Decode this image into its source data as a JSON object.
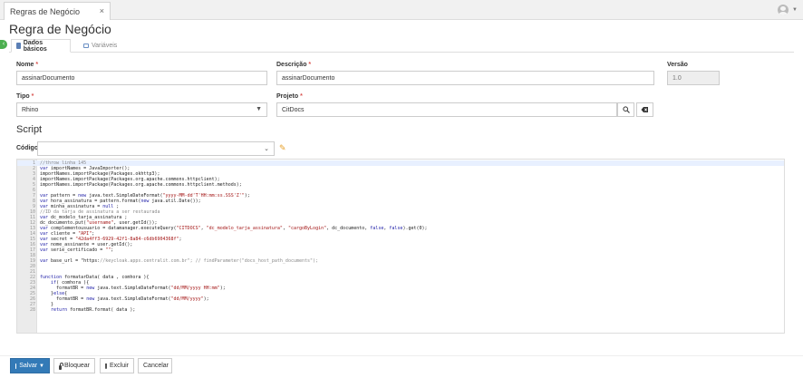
{
  "window": {
    "tab_label": "Regras de Negócio",
    "tab_close": "×"
  },
  "page": {
    "title": "Regra de Negócio"
  },
  "subtabs": [
    {
      "label": "Dados básicos"
    },
    {
      "label": "Variáveis"
    }
  ],
  "form": {
    "nome_label": "Nome",
    "nome_value": "assinarDocumento",
    "descricao_label": "Descrição",
    "descricao_value": "assinarDocumento",
    "versao_label": "Versão",
    "versao_value": "1.0",
    "tipo_label": "Tipo",
    "tipo_value": "Rhino",
    "projeto_label": "Projeto",
    "projeto_value": "CitDocs",
    "required_mark": "*"
  },
  "script": {
    "section_title": "Script",
    "codigo_label": "Código",
    "codigo_value": ""
  },
  "code_lines": [
    {
      "n": "1",
      "t": "//throw linha 145"
    },
    {
      "n": "2",
      "t": "var importNames = JavaImporter();"
    },
    {
      "n": "3",
      "t": "importNames.importPackage(Packages.okhttp3);"
    },
    {
      "n": "4",
      "t": "importNames.importPackage(Packages.org.apache.commons.httpclient);"
    },
    {
      "n": "5",
      "t": "importNames.importPackage(Packages.org.apache.commons.httpclient.methods);"
    },
    {
      "n": "6",
      "t": ""
    },
    {
      "n": "7",
      "t": "var pattern = new java.text.SimpleDateFormat(\"yyyy-MM-dd'T'HH:mm:ss.SSS'Z'\");"
    },
    {
      "n": "8",
      "t": "var hora_assinatura = pattern.format(new java.util.Date());"
    },
    {
      "n": "9",
      "t": "var minha_assinatura = null ;"
    },
    {
      "n": "10",
      "t": "//ID da tarja de assinatura a ser restaurada"
    },
    {
      "n": "11",
      "t": "var dc_modelo_tarja_assinatura ;"
    },
    {
      "n": "12",
      "t": "dc_documento.put(\"username\", user.getId());"
    },
    {
      "n": "13",
      "t": "var complementousuario = datamanager.executeQuery(\"CITDOCS\", \"dc_modelo_tarja_assinatura\", \"cargoByLogin\", dc_documento, false, false).get(0);"
    },
    {
      "n": "14",
      "t": "var cliente = \"API\";"
    },
    {
      "n": "15",
      "t": "var secret = \"42da4ff3-6929-42f1-8a84-c6db6904368f\";"
    },
    {
      "n": "16",
      "t": "var nome_assinante = user.getId();"
    },
    {
      "n": "17",
      "t": "var serie_certificado = \"\";"
    },
    {
      "n": "18",
      "t": ""
    },
    {
      "n": "19",
      "t": "var base_url = \"https://keycloak.apps.centralit.com.br\"; // findParameter(\"docs_host_path_documents\");"
    },
    {
      "n": "20",
      "t": ""
    },
    {
      "n": "21",
      "t": ""
    },
    {
      "n": "22",
      "t": "function formatarData( data , comhora ){"
    },
    {
      "n": "23",
      "t": "    if( comhora ){"
    },
    {
      "n": "24",
      "t": "      formatBR = new java.text.SimpleDateFormat(\"dd/MM/yyyy HH:mm\");"
    },
    {
      "n": "25",
      "t": "    }else{"
    },
    {
      "n": "26",
      "t": "      formatBR = new java.text.SimpleDateFormat(\"dd/MM/yyyy\");"
    },
    {
      "n": "27",
      "t": "    }"
    },
    {
      "n": "28",
      "t": "    return formatBR.format( data );"
    }
  ],
  "colors": {
    "code_comment": "#8a8a8a",
    "code_keyword": "#1a1aa6",
    "code_string": "#a31515",
    "primary": "#337ab7",
    "toggle": "#4caf50",
    "pencil": "#e6a02a"
  },
  "footer": {
    "save_label": "Salvar",
    "lock_label": "Bloquear",
    "delete_label": "Excluir",
    "cancel_label": "Cancelar"
  },
  "icons": {
    "search": "search-icon",
    "eraser": "eraser-icon",
    "pencil": "pencil-icon",
    "user": "user-icon"
  }
}
